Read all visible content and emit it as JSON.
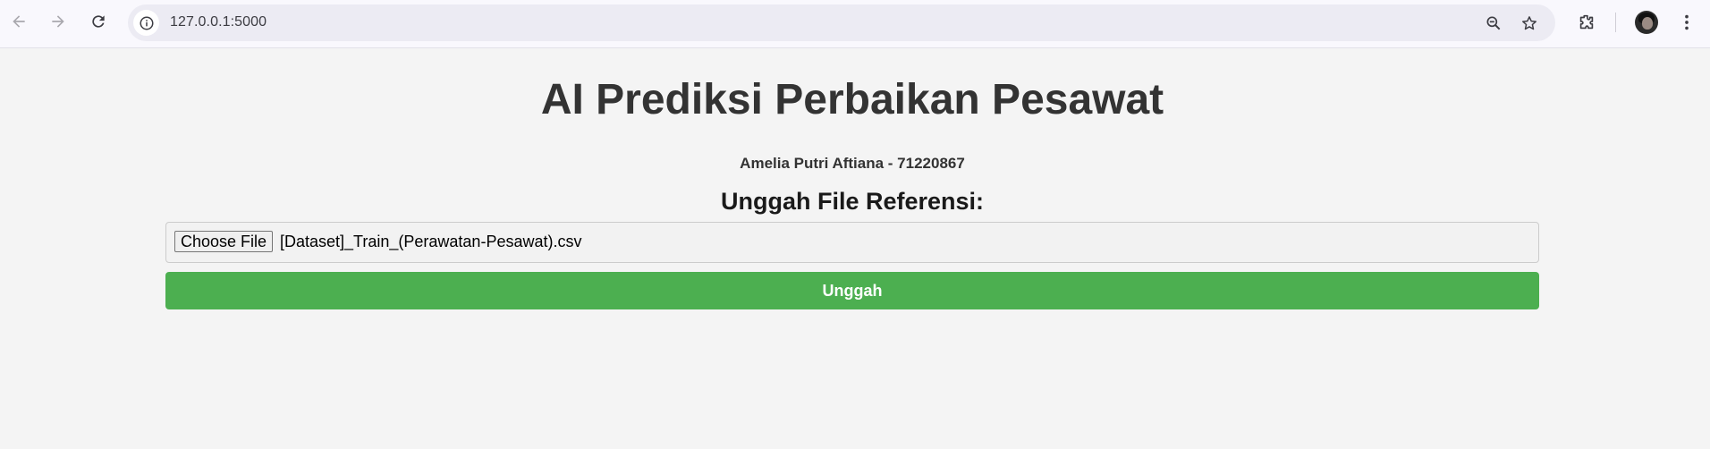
{
  "browser": {
    "url": "127.0.0.1:5000",
    "icons": [
      "back-icon",
      "forward-icon",
      "reload-icon",
      "site-info-icon",
      "zoom-icon",
      "star-icon",
      "extensions-icon",
      "avatar",
      "menu-icon"
    ]
  },
  "page": {
    "title": "AI Prediksi Perbaikan Pesawat",
    "subtitle": "Amelia Putri Aftiana - 71220867",
    "upload_heading": "Unggah File Referensi:",
    "file_input": {
      "button_label": "Choose File",
      "selected_file": "[Dataset]_Train_(Perawatan-Pesawat).csv"
    },
    "submit_label": "Unggah"
  },
  "colors": {
    "submit_button": "#4caf50",
    "page_background": "#f4f4f4",
    "heading_text": "#333333"
  }
}
